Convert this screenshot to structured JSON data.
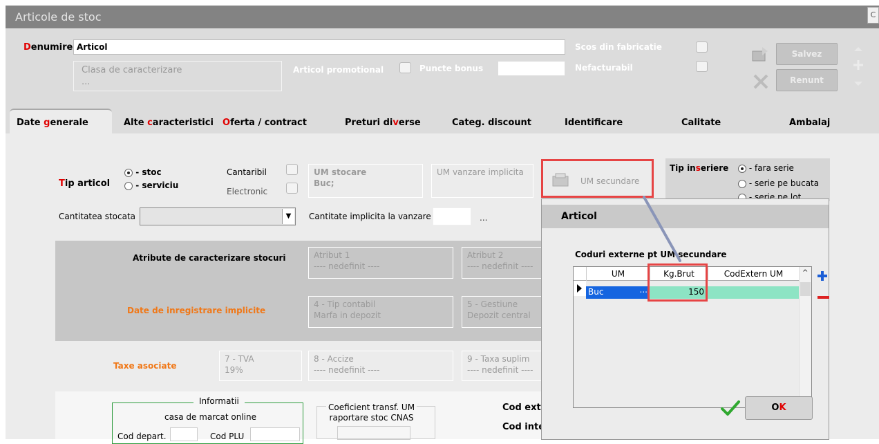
{
  "window": {
    "title": "Articole de stoc",
    "corner_button": "C"
  },
  "header": {
    "denumire_label_first": "D",
    "denumire_label_rest": "enumire",
    "denumire_value": "Articol",
    "clasa_label": "Clasa de caracterizare",
    "clasa_value": "...",
    "promo_label": "Articol promotional",
    "puncte_label": "Puncte bonus",
    "puncte_value": "",
    "scos_label": "Scos din fabricatie",
    "nefact_label": "Nefacturabil",
    "salvez": "Salvez",
    "renunt": "Renunt"
  },
  "tabs": [
    {
      "pre": "Date ",
      "hot": "g",
      "post": "enerale"
    },
    {
      "pre": "Alte ",
      "hot": "c",
      "post": "aracteristici"
    },
    {
      "pre": "",
      "hot": "O",
      "post": "ferta / contract"
    },
    {
      "pre": "Preturi di",
      "hot": "v",
      "post": "erse"
    },
    {
      "pre": "Categ. discount",
      "hot": "",
      "post": ""
    },
    {
      "pre": "Identificare",
      "hot": "",
      "post": ""
    },
    {
      "pre": "Calitate",
      "hot": "",
      "post": ""
    },
    {
      "pre": "Ambalaj",
      "hot": "",
      "post": ""
    }
  ],
  "general": {
    "tip_hot": "T",
    "tip_rest": "ip articol",
    "stoc": "- stoc",
    "serviciu": "- serviciu",
    "cantaribil": "Cantaribil",
    "electronic": "Electronic",
    "um_stocare_label": "UM stocare",
    "um_stocare_value": "Buc;",
    "um_vanzare": "UM vanzare implicita",
    "um_secundare": "UM secundare",
    "tip_inseriere_pre": "Tip in",
    "tip_inseriere_hot": "s",
    "tip_inseriere_post": "eriere",
    "fara_serie": "- fara serie",
    "serie_bucata": "- serie pe bucata",
    "serie_lot": "- serie pe lot",
    "cantitatea_stocata": "Cantitatea stocata",
    "cant_implicita": "Cantitate implicita la vanzare",
    "ellipsis": "...",
    "atribute_label": "Atribute de caracterizare stocuri",
    "atribut1_label": "Atribut 1",
    "atribut1_value": "---- nedefinit ----",
    "atribut2_label": "Atribut 2",
    "atribut2_value": "---- nedefinit ----",
    "date_inreg": "Date de inregistrare implicite",
    "tip_contabil_label": "4 - Tip contabil",
    "tip_contabil_value": "Marfa in depozit",
    "gestiune_label": "5 - Gestiune",
    "gestiune_value": "Depozit central",
    "taxe": "Taxe asociate",
    "tva_label": "7 - TVA",
    "tva_value": "19%",
    "accize_label": "8 - Accize",
    "accize_value": "---- nedefinit ----",
    "taxa_label": "9 - Taxa suplim",
    "taxa_value": "---- nedefinit ----",
    "informatii": "Informatii",
    "casa": "casa de marcat online",
    "cod_depart": "Cod depart.",
    "cod_plu": "Cod PLU",
    "coef1": "Coeficient transf. UM",
    "coef2": "raportare stoc CNAS",
    "cod_ext": "Cod ext",
    "cod_int": "Cod inte"
  },
  "dialog": {
    "title": "Articol",
    "subtitle": "Coduri externe pt UM secundare",
    "columns": [
      "UM",
      "Kg.Brut",
      "CodExtern UM"
    ],
    "rows": [
      {
        "um": "Buc",
        "kg": "150",
        "cod": ""
      }
    ],
    "ok_hot": "O",
    "ok_rest": "K"
  },
  "colors": {
    "accent_red": "#e00000",
    "orange": "#f07818",
    "highlight": "#8de4c4",
    "selected_blue": "#1565e0",
    "annotation_red": "#e64444"
  }
}
